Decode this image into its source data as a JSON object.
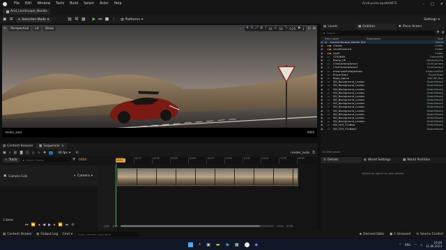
{
  "app": {
    "project_name": "AridLandscapeNANITE",
    "level_tab": "Arid_Landscape_Nanite",
    "window_controls": [
      "–",
      "□",
      "×"
    ]
  },
  "menu": [
    "File",
    "Edit",
    "Window",
    "Tools",
    "Build",
    "Select",
    "Actor",
    "Help"
  ],
  "toolbar": {
    "mode": "Selection Mode",
    "platforms": "Platforms",
    "settings": "Settings"
  },
  "viewport": {
    "perspective": "Perspective",
    "lit": "Lit",
    "show": "Show",
    "grid_snap": "10",
    "rot_snap": "10",
    "scale_snap": "0.25",
    "cam_speed": "1",
    "render_label": "render_auto",
    "frame_label": "0000"
  },
  "outliner": {
    "tabs": [
      "Levels",
      "Outliner",
      "Place Actors"
    ],
    "search_placeholder": "Search...",
    "col_label": "Item Label",
    "col_seq": "Sequencer",
    "col_type": "Type",
    "items": [
      {
        "label": "AridLandscape_Nanite (Ed",
        "type": "World"
      },
      {
        "label": "Clouds",
        "type": "Folder"
      },
      {
        "label": "LevelInstance",
        "type": "Folder"
      },
      {
        "label": "Light",
        "type": "Folder"
      },
      {
        "label": "7254646",
        "type": "ExtendHB"
      },
      {
        "label": "Brano_UE",
        "type": "GeometryCo"
      },
      {
        "label": "CineCameraActor1",
        "type": "CineCamera"
      },
      {
        "label": "CineCameraActor2",
        "type": "CineCamera"
      },
      {
        "label": "InstancedFoliageActor",
        "type": "InstancedFoli"
      },
      {
        "label": "PlayerStart",
        "type": "PlayerStart"
      },
      {
        "label": "Road_Spline",
        "type": "Edit BP_Roa"
      },
      {
        "label": "SM_Background_Landsc",
        "type": "StaticMeshA"
      },
      {
        "label": "SM_Background_Landsc",
        "type": "StaticMeshA"
      },
      {
        "label": "SM_Background_Landsc",
        "type": "StaticMeshA"
      },
      {
        "label": "SM_Background_Landsc",
        "type": "StaticMeshA"
      },
      {
        "label": "SM_Background_Landsc",
        "type": "StaticMeshA"
      },
      {
        "label": "SM_Background_Landsc",
        "type": "StaticMeshA"
      },
      {
        "label": "SM_Background_Landsc",
        "type": "StaticMeshA"
      },
      {
        "label": "SM_Background_Landsc",
        "type": "StaticMeshA"
      },
      {
        "label": "SM_Background_Landsc",
        "type": "StaticMeshA"
      },
      {
        "label": "SM_Background_Landsc",
        "type": "StaticMeshA"
      },
      {
        "label": "SM_Background_Landsc",
        "type": "StaticMeshA"
      },
      {
        "label": "SM_Background_Landsc",
        "type": "StaticMeshA"
      },
      {
        "label": "SM_Cliff_72cBba",
        "type": "StaticMeshA"
      },
      {
        "label": "SM_Cliff_72cBBa2",
        "type": "StaticMeshA"
      }
    ],
    "count": "15,456 actors"
  },
  "details": {
    "tabs": [
      "Details",
      "World Settings",
      "World Partition"
    ],
    "empty": "Select an object to view details."
  },
  "sequencer": {
    "tabs": [
      "Content Browser",
      "Sequencer"
    ],
    "fps": "30 fps",
    "sequence_name": "render_auto",
    "track_button": "Track",
    "search_placeholder": "Search Tracks",
    "current_frame": "0000",
    "track_name": "Camera Cuts",
    "add_camera": "Camera",
    "items_count": "1 items",
    "range_start": "-015",
    "range_start2": "-015",
    "range_end": "0720",
    "range_end2": "0735",
    "ruler": [
      "0000",
      "0015",
      "0030",
      "0045",
      "0060",
      "0075",
      "0090",
      "0105",
      "0120",
      "0135",
      "0150"
    ]
  },
  "statusbar": {
    "content_drawer": "Content Drawer",
    "output_log": "Output Log",
    "cmd": "Cmd",
    "cmd_placeholder": "Enter Console Command",
    "derived_data": "Derived Data",
    "unsaved": "1 Unsaved",
    "source_control": "Source Control"
  },
  "taskbar": {
    "lang": "ENG",
    "time": "10:09",
    "date": "11.06.2023"
  }
}
